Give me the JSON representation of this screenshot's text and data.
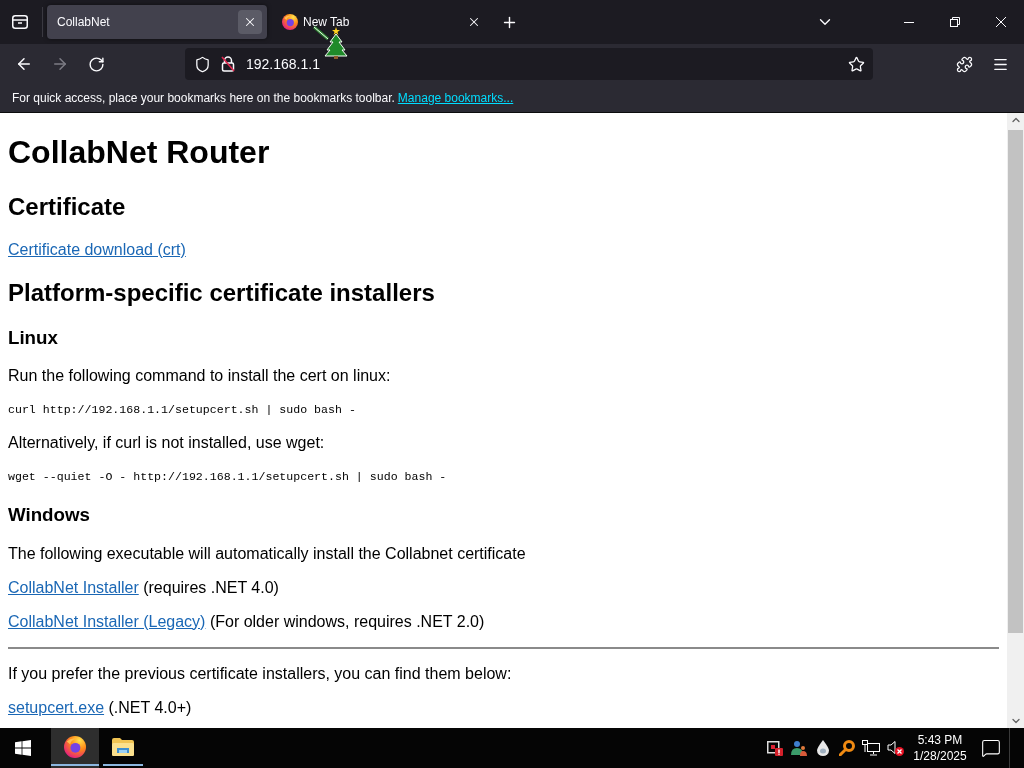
{
  "tabs": [
    {
      "title": "CollabNet",
      "kind": "site",
      "selected": true
    },
    {
      "title": "New Tab",
      "kind": "firefox",
      "selected": false
    }
  ],
  "toolbar": {
    "buttons": [
      {
        "kind": "back",
        "disabled": false
      },
      {
        "kind": "forward",
        "disabled": true
      },
      {
        "kind": "reload",
        "disabled": false
      }
    ],
    "address": "192.168.1.1"
  },
  "bookmarks_toolbar": {
    "message": "For quick access, place your bookmarks here on the bookmarks toolbar.",
    "link": "Manage bookmarks..."
  },
  "page": {
    "blocks": [
      {
        "kind": "h1",
        "text": "CollabNet Router"
      },
      {
        "kind": "h2",
        "text": "Certificate"
      },
      {
        "kind": "paragraph",
        "parts": [
          {
            "kind": "link",
            "text": "Certificate download (crt)"
          }
        ]
      },
      {
        "kind": "h2",
        "text": "Platform-specific certificate installers"
      },
      {
        "kind": "h3",
        "text": "Linux"
      },
      {
        "kind": "paragraph",
        "parts": [
          {
            "kind": "text",
            "text": "Run the following command to install the cert on linux:"
          }
        ]
      },
      {
        "kind": "code",
        "text": "curl http://192.168.1.1/setupcert.sh | sudo bash -"
      },
      {
        "kind": "paragraph",
        "parts": [
          {
            "kind": "text",
            "text": "Alternatively, if curl is not installed, use wget:"
          }
        ]
      },
      {
        "kind": "code",
        "text": "wget --quiet -O - http://192.168.1.1/setupcert.sh | sudo bash -"
      },
      {
        "kind": "h3",
        "text": "Windows"
      },
      {
        "kind": "paragraph",
        "parts": [
          {
            "kind": "text",
            "text": "The following executable will automatically install the Collabnet certificate"
          }
        ]
      },
      {
        "kind": "paragraph",
        "parts": [
          {
            "kind": "link",
            "text": "CollabNet Installer"
          },
          {
            "kind": "text",
            "text": "(requires .NET 4.0)"
          }
        ]
      },
      {
        "kind": "paragraph",
        "parts": [
          {
            "kind": "link",
            "text": "CollabNet Installer (Legacy)"
          },
          {
            "kind": "text",
            "text": "(For older windows, requires .NET 2.0)"
          }
        ]
      },
      {
        "kind": "rule"
      },
      {
        "kind": "paragraph",
        "parts": [
          {
            "kind": "text",
            "text": "If you prefer the previous certificate installers, you can find them below:"
          }
        ]
      },
      {
        "kind": "paragraph",
        "parts": [
          {
            "kind": "link",
            "text": "setupcert.exe"
          },
          {
            "kind": "text",
            "text": "(.NET 4.0+)"
          }
        ]
      }
    ]
  },
  "taskbar": {
    "apps": [
      {
        "kind": "browser",
        "selected": true
      },
      {
        "kind": "file-explorer",
        "selected": false
      }
    ],
    "clock": {
      "time": "5:43 PM",
      "date": "1/28/2025"
    }
  }
}
